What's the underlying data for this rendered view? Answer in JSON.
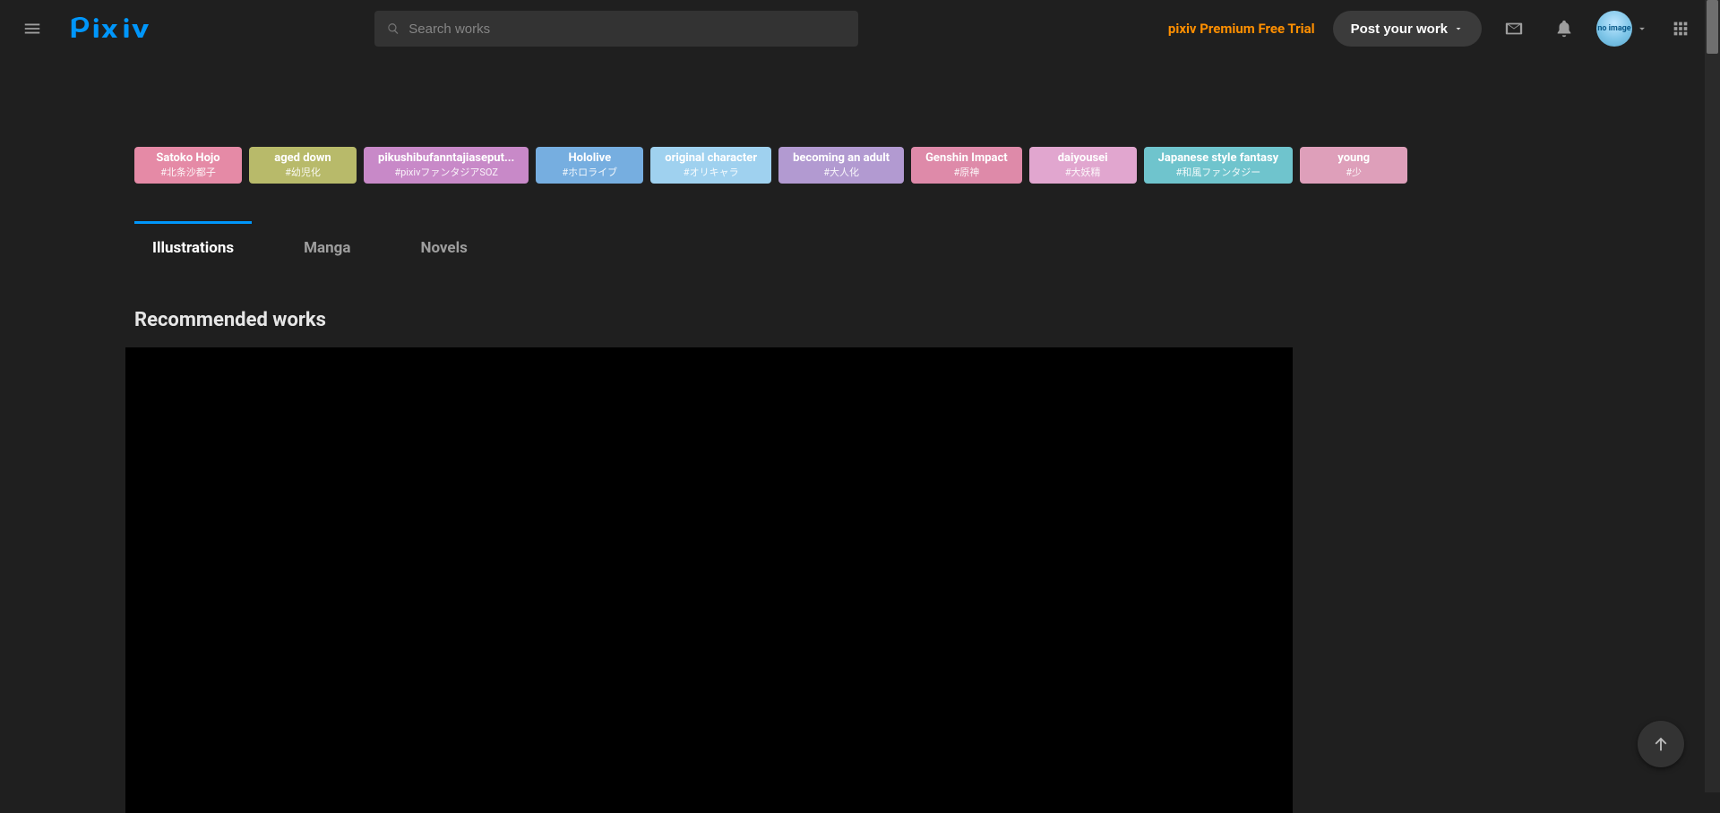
{
  "header": {
    "search_placeholder": "Search works",
    "premium_label": "pixiv Premium Free Trial",
    "post_label": "Post your work"
  },
  "tag_chips": [
    {
      "title": "Satoko Hojo",
      "sub": "#北条沙都子",
      "bg": "#e58aa6"
    },
    {
      "title": "aged down",
      "sub": "#幼児化",
      "bg": "#b8ba6a"
    },
    {
      "title": "pikushibufanntajiaseput...",
      "sub": "#pixivファンタジアSOZ",
      "bg": "#c889c8"
    },
    {
      "title": "Hololive",
      "sub": "#ホロライブ",
      "bg": "#76aee0"
    },
    {
      "title": "original character",
      "sub": "#オリキャラ",
      "bg": "#9fd1ef"
    },
    {
      "title": "becoming an adult",
      "sub": "#大人化",
      "bg": "#b29ad1"
    },
    {
      "title": "Genshin Impact",
      "sub": "#原神",
      "bg": "#de8aa9"
    },
    {
      "title": "daiyousei",
      "sub": "#大妖精",
      "bg": "#e1a6cf"
    },
    {
      "title": "Japanese style fantasy",
      "sub": "#和風ファンタジー",
      "bg": "#6fc4cd"
    },
    {
      "title": "young",
      "sub": "#少",
      "bg": "#de9fba"
    }
  ],
  "tabs": {
    "items": [
      {
        "label": "Illustrations",
        "active": true
      },
      {
        "label": "Manga",
        "active": false
      },
      {
        "label": "Novels",
        "active": false
      }
    ]
  },
  "sections": {
    "recommended_title": "Recommended works"
  }
}
